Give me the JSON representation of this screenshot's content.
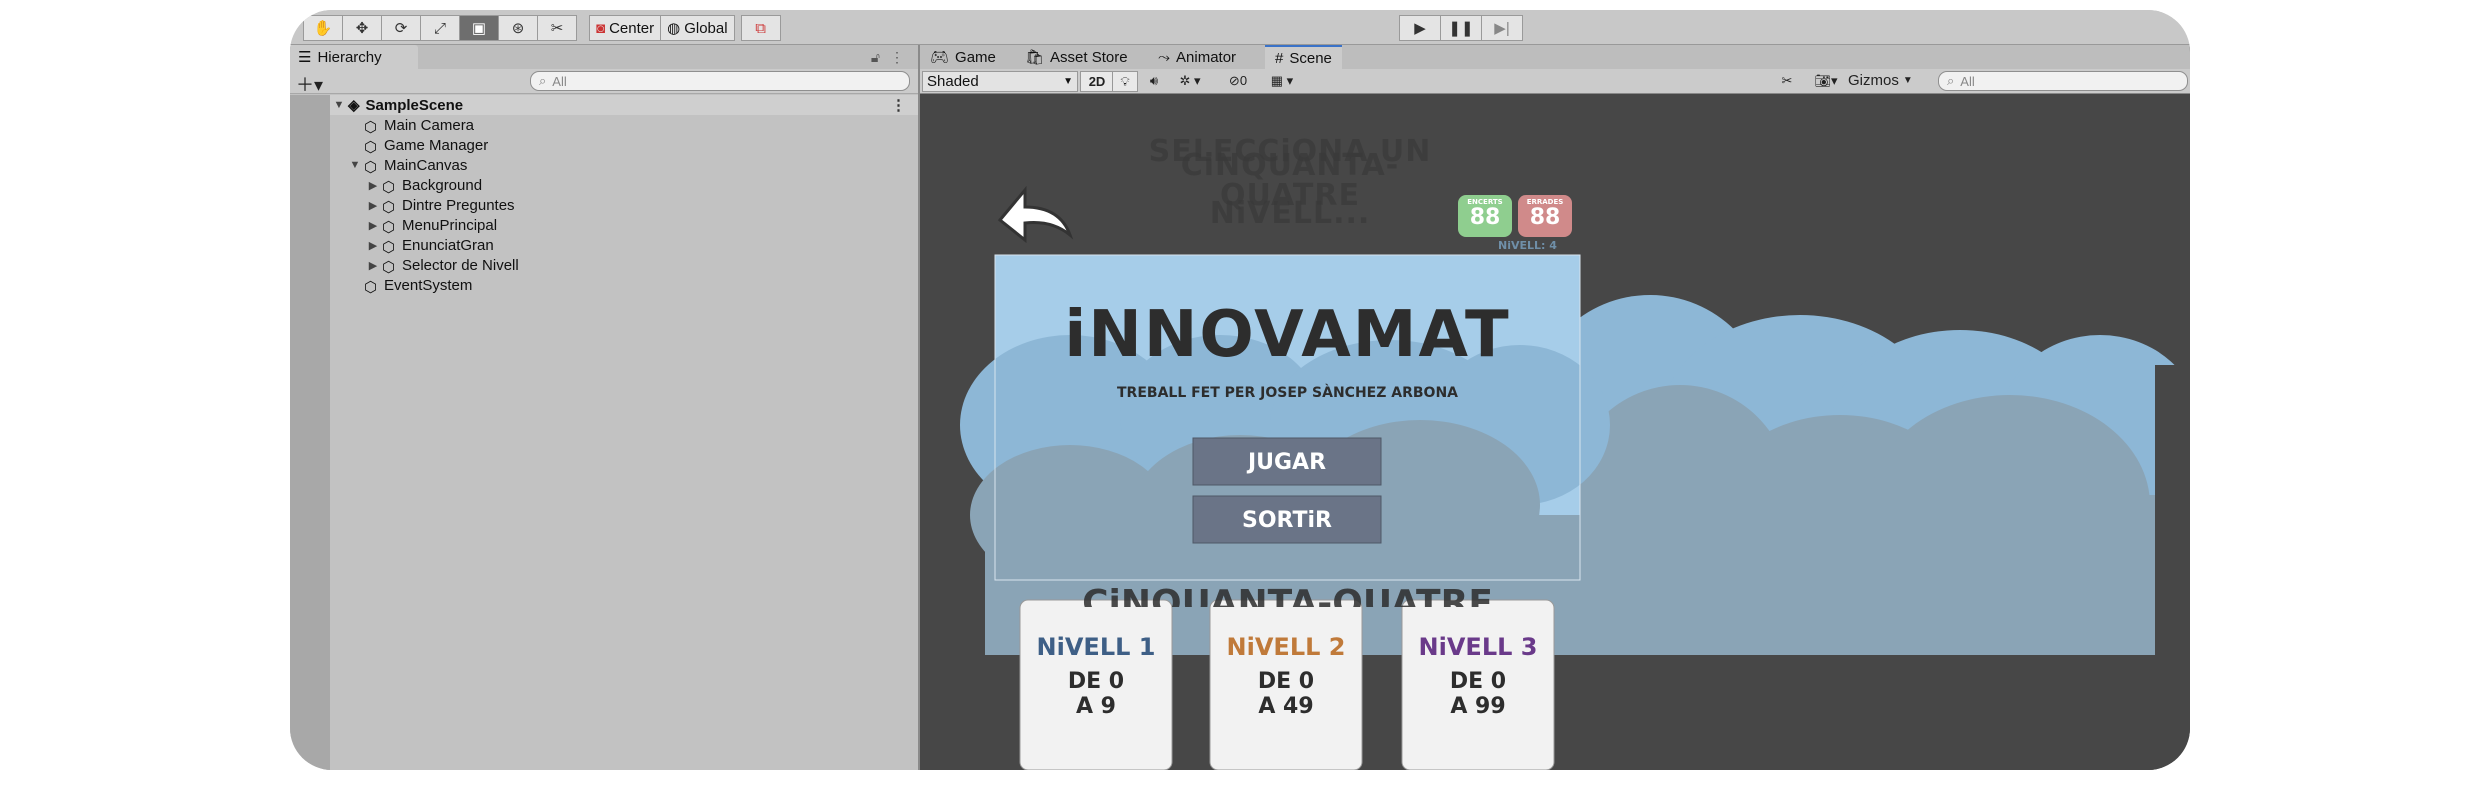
{
  "toolbar": {
    "tools": [
      "hand-icon",
      "move-icon",
      "rotate-icon",
      "scale-icon",
      "rect-icon",
      "transform-icon",
      "custom-tool-icon"
    ],
    "center_label": "Center",
    "global_label": "Global"
  },
  "hierarchy": {
    "tab_label": "Hierarchy",
    "search_placeholder": "All",
    "scene_name": "SampleScene",
    "items": [
      {
        "label": "Main Camera"
      },
      {
        "label": "Game Manager"
      },
      {
        "label": "MainCanvas"
      },
      {
        "label": "Background"
      },
      {
        "label": "Dintre Preguntes"
      },
      {
        "label": "MenuPrincipal"
      },
      {
        "label": "EnunciatGran"
      },
      {
        "label": "Selector de Nivell"
      },
      {
        "label": "EventSystem"
      }
    ]
  },
  "scene_tabs": {
    "game": "Game",
    "asset_store": "Asset Store",
    "animator": "Animator",
    "scene": "Scene"
  },
  "scene_controls": {
    "shading_mode": "Shaded",
    "mode_2d": "2D",
    "hidden_count": "0",
    "gizmos": "Gizmos",
    "search_placeholder": "All"
  },
  "game": {
    "title": "iNNOVAMAT",
    "credit": "TREBALL FET PER JOSEP SÀNCHEZ ARBONA",
    "play_button": "JUGAR",
    "exit_button": "SORTiR",
    "heading_overlap_1": "SELECCiONA UN",
    "heading_overlap_2": "CiNQUANTA-QUATRE",
    "heading_overlap_3": "NiVELL...",
    "bottom_overlap": "CiNQUANTA-QUATRE",
    "score_correct_label": "ENCERTS",
    "score_correct_value": "88",
    "score_wrong_label": "ERRADES",
    "score_wrong_value": "88",
    "level_indicator": "NiVELL: 4",
    "levels": [
      {
        "name": "NiVELL 1",
        "line1": "DE 0",
        "line2": "A 9",
        "color": "#3e5f86"
      },
      {
        "name": "NiVELL 2",
        "line1": "DE 0",
        "line2": "A 49",
        "color": "#c07a3a"
      },
      {
        "name": "NiVELL 3",
        "line1": "DE 0",
        "line2": "A 99",
        "color": "#6a3a8a"
      }
    ],
    "colors": {
      "sky": "#a6cde9",
      "cloud_back": "#8db7d6",
      "cloud_front": "#8aa4b6",
      "button": "#6a7487",
      "correct": "#8fce8f",
      "wrong": "#d08a8a"
    }
  }
}
